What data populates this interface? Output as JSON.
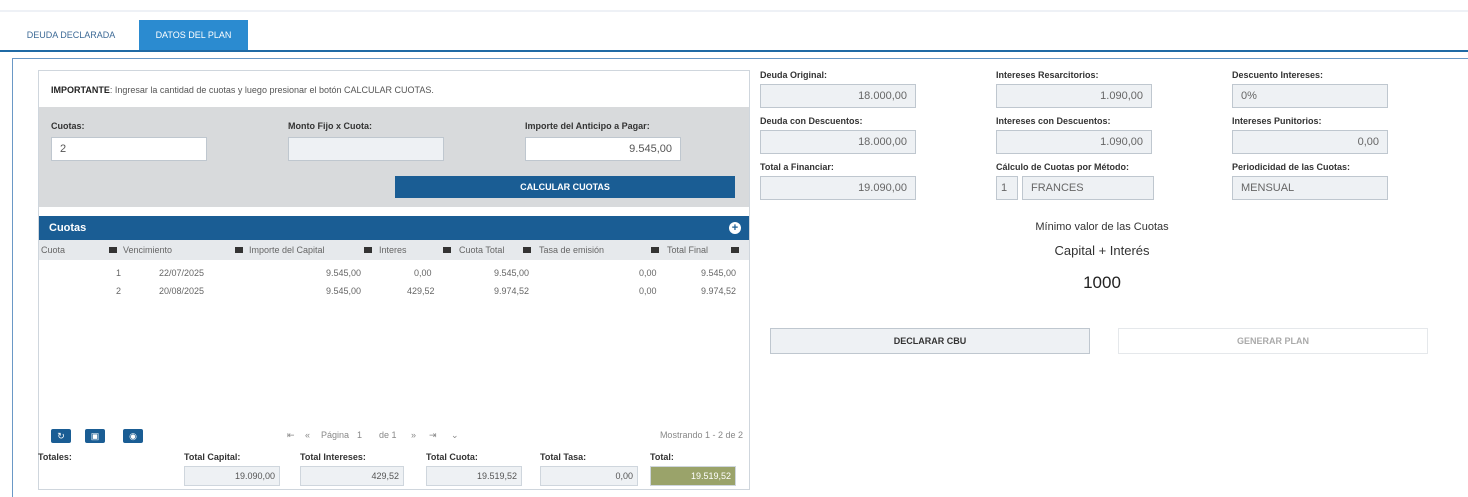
{
  "tabs": [
    {
      "label": "DEUDA DECLARADA"
    },
    {
      "label": "DATOS DEL PLAN"
    }
  ],
  "note": {
    "bold": "IMPORTANTE",
    "text": ": Ingresar la cantidad de cuotas y luego presionar el botón CALCULAR CUOTAS."
  },
  "form": {
    "cuotas_label": "Cuotas:",
    "cuotas_value": "2",
    "monto_label": "Monto Fijo x Cuota:",
    "monto_value": "",
    "anticipo_label": "Importe del Anticipo a Pagar:",
    "anticipo_value": "9.545,00",
    "calc_button": "CALCULAR CUOTAS"
  },
  "grid": {
    "title": "Cuotas",
    "columns": [
      "Cuota",
      "Vencimiento",
      "Importe del Capital",
      "Interes",
      "Cuota Total",
      "Tasa de emisión",
      "Total Final"
    ],
    "rows": [
      {
        "cuota": "1",
        "venc": "22/07/2025",
        "capital": "9.545,00",
        "interes": "0,00",
        "total": "9.545,00",
        "tasa": "0,00",
        "final": "9.545,00"
      },
      {
        "cuota": "2",
        "venc": "20/08/2025",
        "capital": "9.545,00",
        "interes": "429,52",
        "total": "9.974,52",
        "tasa": "0,00",
        "final": "9.974,52"
      }
    ],
    "pager": {
      "page_label": "Página",
      "page": "1",
      "of_label": "de 1",
      "showing": "Mostrando 1 - 2 de 2"
    }
  },
  "totals": {
    "label": "Totales:",
    "capital_label": "Total Capital:",
    "capital": "19.090,00",
    "intereses_label": "Total Intereses:",
    "intereses": "429,52",
    "cuota_label": "Total Cuota:",
    "cuota": "19.519,52",
    "tasa_label": "Total Tasa:",
    "tasa": "0,00",
    "total_label": "Total:",
    "total": "19.519,52"
  },
  "summary": {
    "deuda_original_label": "Deuda Original:",
    "deuda_original": "18.000,00",
    "int_resarcitorios_label": "Intereses Resarcitorios:",
    "int_resarcitorios": "1.090,00",
    "desc_intereses_label": "Descuento Intereses:",
    "desc_intereses": "0%",
    "deuda_desc_label": "Deuda con Descuentos:",
    "deuda_desc": "18.000,00",
    "int_desc_label": "Intereses con Descuentos:",
    "int_desc": "1.090,00",
    "int_punitorios_label": "Intereses Punitorios:",
    "int_punitorios": "0,00",
    "total_fin_label": "Total a Financiar:",
    "total_fin": "19.090,00",
    "metodo_label": "Cálculo de Cuotas por Método:",
    "metodo_code": "1",
    "metodo": "FRANCES",
    "periodicidad_label": "Periodicidad de las Cuotas:",
    "periodicidad": "MENSUAL"
  },
  "minimo": {
    "line1": "Mínimo valor de las Cuotas",
    "line2": "Capital + Interés",
    "value": "1000"
  },
  "actions": {
    "declarar": "DECLARAR CBU",
    "generar": "GENERAR PLAN"
  }
}
